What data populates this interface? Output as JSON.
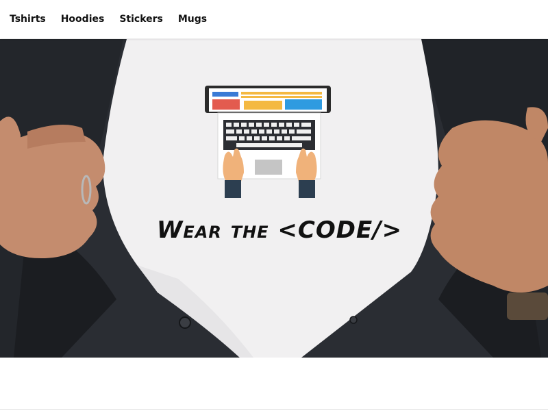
{
  "nav": {
    "items": [
      {
        "label": "Tshirts"
      },
      {
        "label": "Hoodies"
      },
      {
        "label": "Stickers"
      },
      {
        "label": "Mugs"
      }
    ]
  },
  "hero": {
    "headline": "Wear the <CODE/>",
    "colors": {
      "shirt_dark": "#2a2d33",
      "tee_white": "#f1f0f1",
      "skin": "#c48c6e",
      "laptop_frame": "#2b2b2b"
    },
    "icons": [
      "laptop-icon",
      "typing-hands-icon"
    ]
  }
}
